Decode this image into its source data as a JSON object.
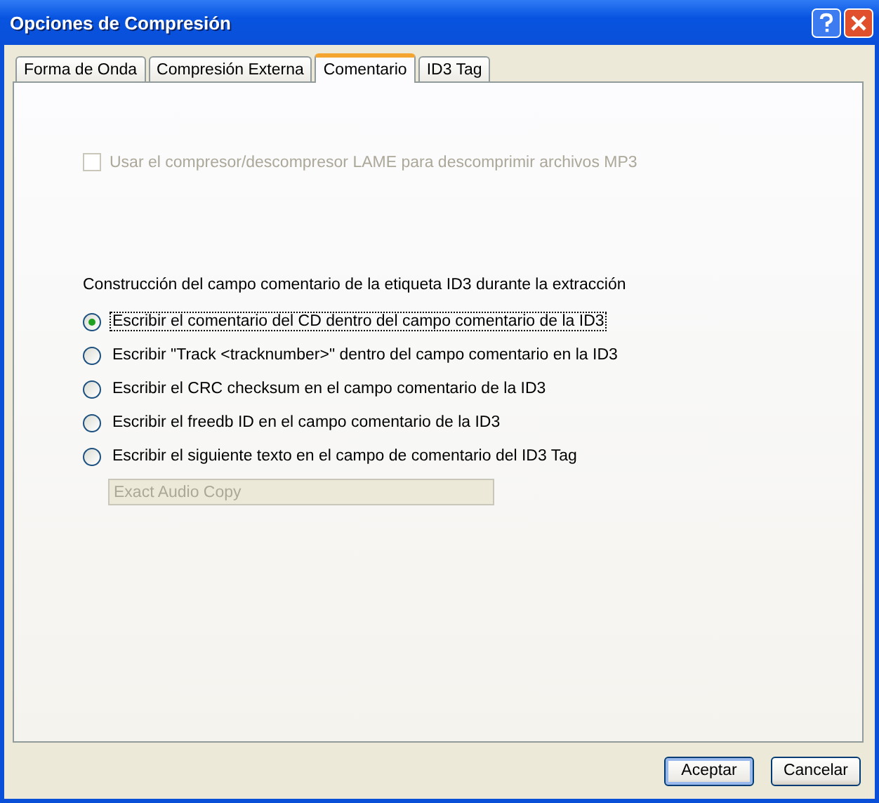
{
  "window": {
    "title": "Opciones de Compresión"
  },
  "tabs": [
    {
      "label": "Forma de Onda",
      "selected": false
    },
    {
      "label": "Compresión Externa",
      "selected": false
    },
    {
      "label": "Comentario",
      "selected": true
    },
    {
      "label": "ID3 Tag",
      "selected": false
    }
  ],
  "lame_checkbox": {
    "label": "Usar el compresor/descompresor LAME para descomprimir archivos MP3",
    "checked": false,
    "disabled": true
  },
  "comment_group": {
    "label": "Construcción del campo comentario de la etiqueta ID3 durante la extracción",
    "options": [
      {
        "label": "Escribir el comentario del CD dentro del campo comentario de la ID3",
        "selected": true
      },
      {
        "label": "Escribir \"Track <tracknumber>\" dentro del campo comentario en la ID3",
        "selected": false
      },
      {
        "label": "Escribir el CRC checksum en el campo comentario de la ID3",
        "selected": false
      },
      {
        "label": "Escribir el freedb ID en el campo comentario de la ID3",
        "selected": false
      },
      {
        "label": "Escribir el siguiente texto en el campo de comentario del ID3 Tag",
        "selected": false
      }
    ],
    "custom_text": {
      "value": "Exact Audio Copy",
      "disabled": true
    }
  },
  "buttons": [
    {
      "label": "Aceptar",
      "default": true
    },
    {
      "label": "Cancelar",
      "default": false
    }
  ]
}
